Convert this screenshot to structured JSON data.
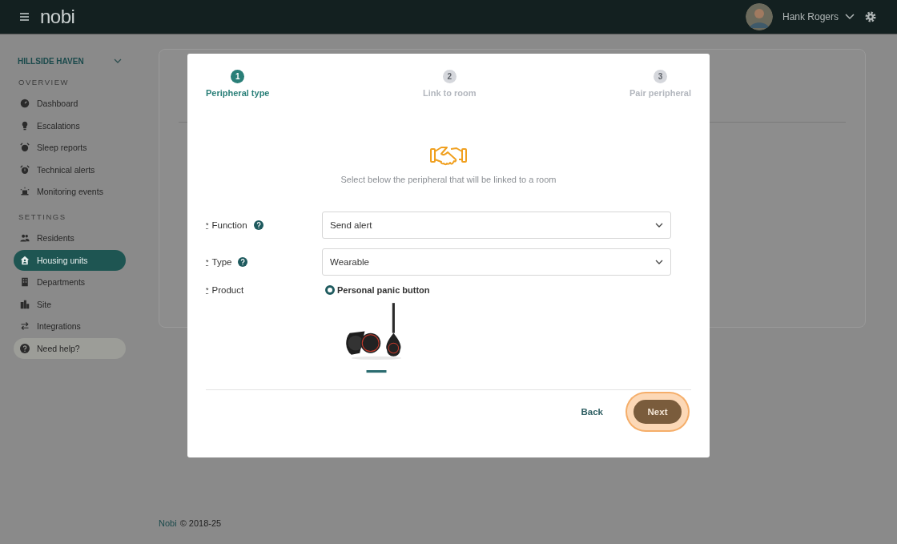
{
  "header": {
    "logo": "nobi",
    "user_name": "Hank Rogers"
  },
  "sidebar": {
    "site": "HILLSIDE HAVEN",
    "sections": [
      {
        "heading": "OVERVIEW",
        "items": [
          {
            "label": "Dashboard",
            "selected": false
          },
          {
            "label": "Escalations",
            "selected": false
          },
          {
            "label": "Sleep reports",
            "selected": false
          },
          {
            "label": "Technical alerts",
            "selected": false
          },
          {
            "label": "Monitoring events",
            "selected": false
          }
        ]
      },
      {
        "heading": "SETTINGS",
        "items": [
          {
            "label": "Residents",
            "selected": false
          },
          {
            "label": "Housing units",
            "selected": true
          },
          {
            "label": "Departments",
            "selected": false
          },
          {
            "label": "Site",
            "selected": false
          },
          {
            "label": "Integrations",
            "selected": false
          }
        ]
      }
    ],
    "help": "Need help?"
  },
  "modal": {
    "steps": [
      {
        "number": "1",
        "label": "Peripheral type",
        "selected": true
      },
      {
        "number": "2",
        "label": "Link to room",
        "selected": false
      },
      {
        "number": "3",
        "label": "Pair peripheral",
        "selected": false
      }
    ],
    "description": "Select below the peripheral that will be linked to a room",
    "fields": [
      {
        "kind": "select",
        "required_mark": "*",
        "label": "Function",
        "help": true,
        "value": "Send alert"
      },
      {
        "kind": "select",
        "required_mark": "*",
        "label": "Type",
        "help": true,
        "value": "Wearable"
      },
      {
        "kind": "radio",
        "required_mark": "*",
        "label": "Product",
        "help": false,
        "options": [
          {
            "label": "Personal panic button",
            "selected": true,
            "kind": "picture"
          }
        ]
      }
    ],
    "back": "Back",
    "next": "Next"
  },
  "footer": {
    "brand": "Nobi",
    "copyright": "© 2018-25"
  }
}
